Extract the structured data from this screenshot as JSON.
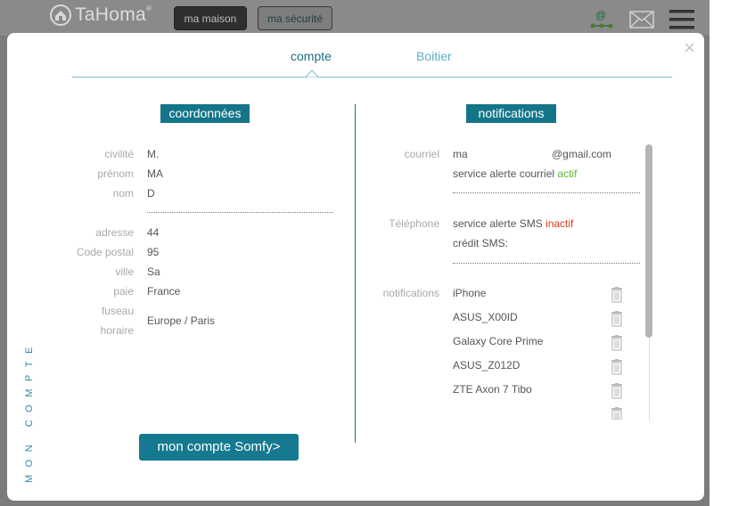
{
  "header": {
    "brand": "TaHoma",
    "brand_reg": "®",
    "btn_maison": "ma maison",
    "btn_securite": "ma sécurité"
  },
  "tabs": {
    "compte": "compte",
    "boitier": "Boitier"
  },
  "close_label": "×",
  "coordonnees": {
    "title": "coordonnées",
    "civilite_label": "civilité",
    "civilite_value": "M.",
    "prenom_label": "prénom",
    "prenom_value": "MA",
    "nom_label": "nom",
    "nom_value": "D",
    "adresse_label": "adresse",
    "adresse_value": "44",
    "cp_label": "Code postal",
    "cp_value": "95",
    "ville_label": "ville",
    "ville_value": "Sa",
    "pays_label": "paie",
    "pays_value": "France",
    "fuseau_label1": "fuseau",
    "fuseau_label2": "horaire",
    "fuseau_value": "Europe / Paris"
  },
  "notifications": {
    "title": "notifications",
    "courriel_label": "courriel",
    "courriel_prefix": "ma",
    "courriel_domain": "@gmail.com",
    "email_alert_text": "service alerte courriel",
    "email_alert_status": "actif",
    "telephone_label": "Téléphone",
    "sms_alert_text": "service alerte SMS",
    "sms_alert_status": "inactif",
    "sms_credit": "crédit SMS:",
    "devices_label": "notifications",
    "devices": [
      "iPhone",
      "ASUS_X00ID",
      "Galaxy Core Prime",
      "ASUS_Z012D",
      "ZTE Axon 7 Tibo"
    ]
  },
  "side_label": "MON COMPTE",
  "somfy_button": "mon compte Somfy>",
  "colors": {
    "accent": "#147589",
    "active": "#5cb82a",
    "inactive": "#d63a1e"
  }
}
